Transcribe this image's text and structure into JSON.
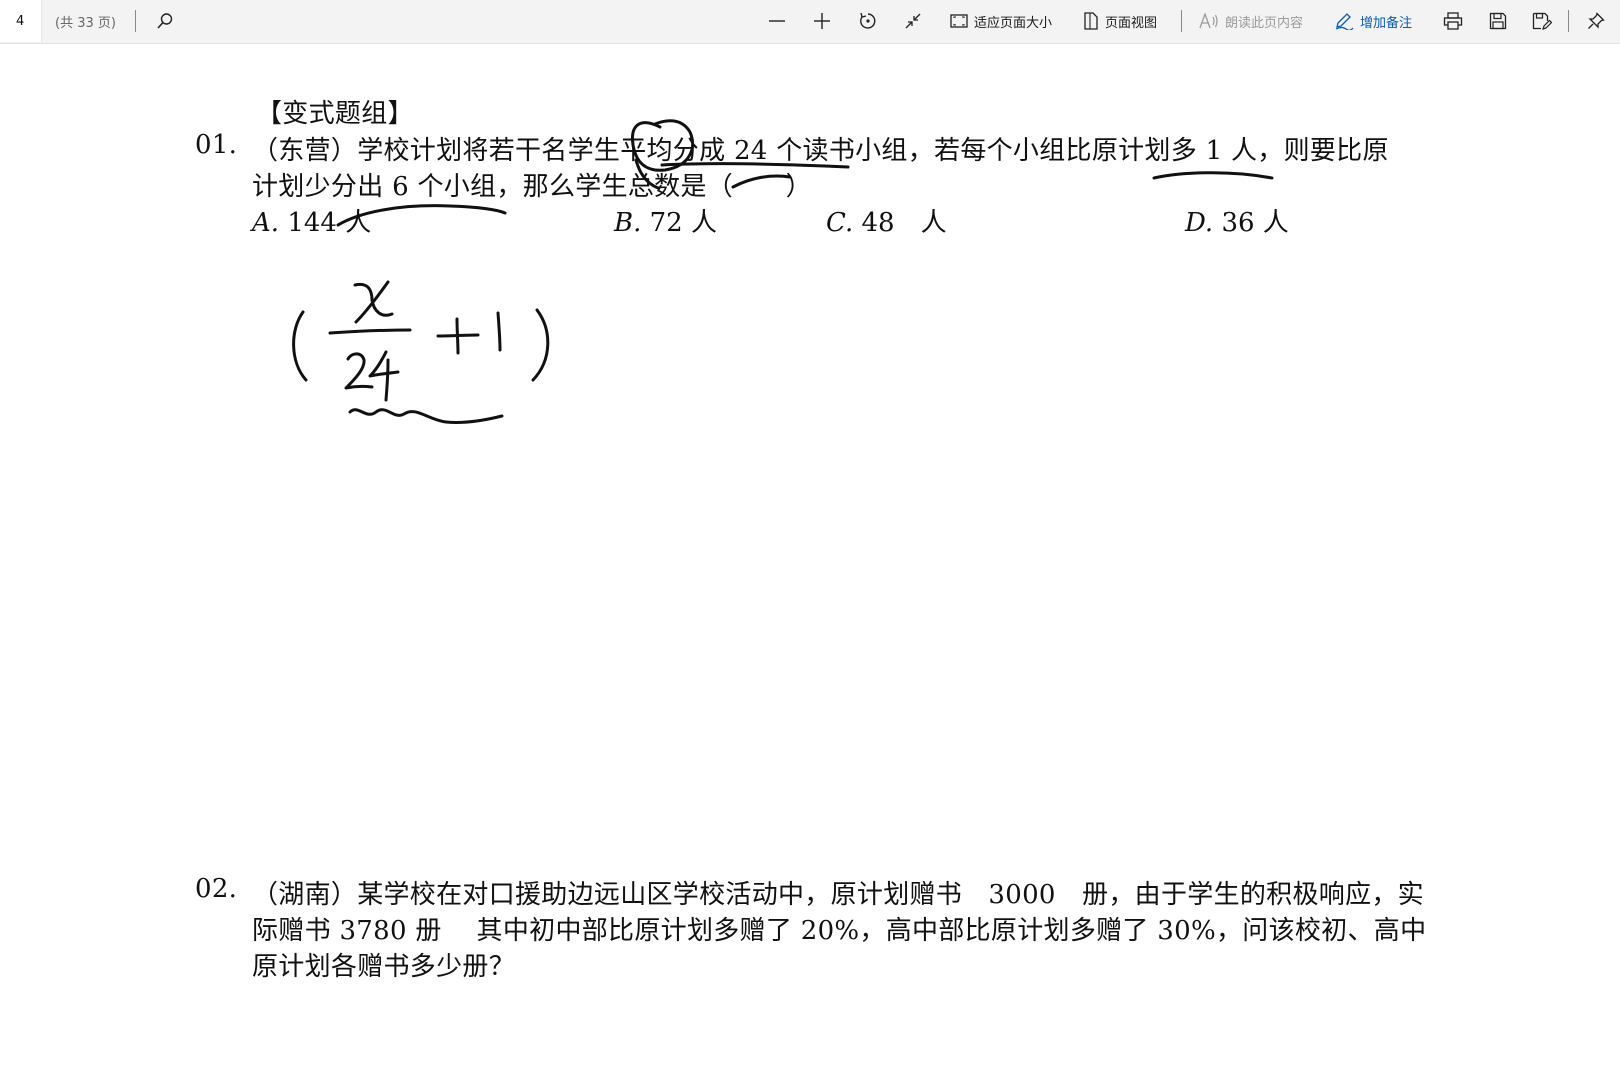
{
  "toolbar": {
    "page_number": "4",
    "page_total": "(共 33 页)",
    "fit_page_label": "适应页面大小",
    "page_view_label": "页面视图",
    "read_aloud_label": "朗读此页内容",
    "add_notes_label": "增加备注",
    "accent_color": "#0b5cb0",
    "icons": [
      "search-icon",
      "zoom-out-icon",
      "zoom-in-icon",
      "rotate-icon",
      "fit-width-icon",
      "fit-page-icon",
      "page-view-icon",
      "read-aloud-icon",
      "add-notes-pen-icon",
      "print-icon",
      "save-icon",
      "save-as-icon",
      "pin-icon"
    ]
  },
  "document": {
    "section_heading": "【变式题组】",
    "q1": {
      "number": "01.",
      "line1": "（东营）学校计划将若干名学生平均分成 24 个读书小组，若每个小组比原计划多 1 人，则要比原",
      "line2": "计划少分出 6 个小组，那么学生总数是（　　）",
      "options": [
        {
          "letter": "A.",
          "text": "144 人"
        },
        {
          "letter": "B.",
          "text": "72 人"
        },
        {
          "letter": "C.",
          "text": "48　人"
        },
        {
          "letter": "D.",
          "text": "36 人"
        }
      ]
    },
    "handwriting": {
      "numerator": "x",
      "denominator": "24",
      "plus_one": "+1",
      "ink_color": "#111111"
    },
    "q2": {
      "number": "02.",
      "line1": "（湖南）某学校在对口援助边远山区学校活动中，原计划赠书　3000　册，由于学生的积极响应，实",
      "line2": "际赠书 3780 册　 其中初中部比原计划多赠了 20%，高中部比原计划多赠了 30%，问该校初、高中",
      "line3": "原计划各赠书多少册？"
    }
  }
}
